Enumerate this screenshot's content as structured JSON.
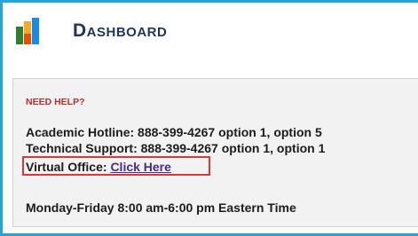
{
  "header": {
    "title": "Dashboard",
    "logo_icon": "bar-chart-icon"
  },
  "help": {
    "heading": "NEED HELP?",
    "academic_label": "Academic Hotline: 888-399-4267 option 1, option 5",
    "technical_label": "Technical Support: 888-399-4267 option 1, option 1",
    "virtual_office_label": "Virtual Office:",
    "virtual_office_link": "Click Here",
    "hours": "Monday-Friday 8:00 am-6:00 pm Eastern Time"
  },
  "colors": {
    "border_accent": "#29a3d6",
    "title": "#1f3658",
    "help_heading": "#b0312e",
    "highlight_box": "#d33b3b",
    "link": "#4a2a8a"
  }
}
